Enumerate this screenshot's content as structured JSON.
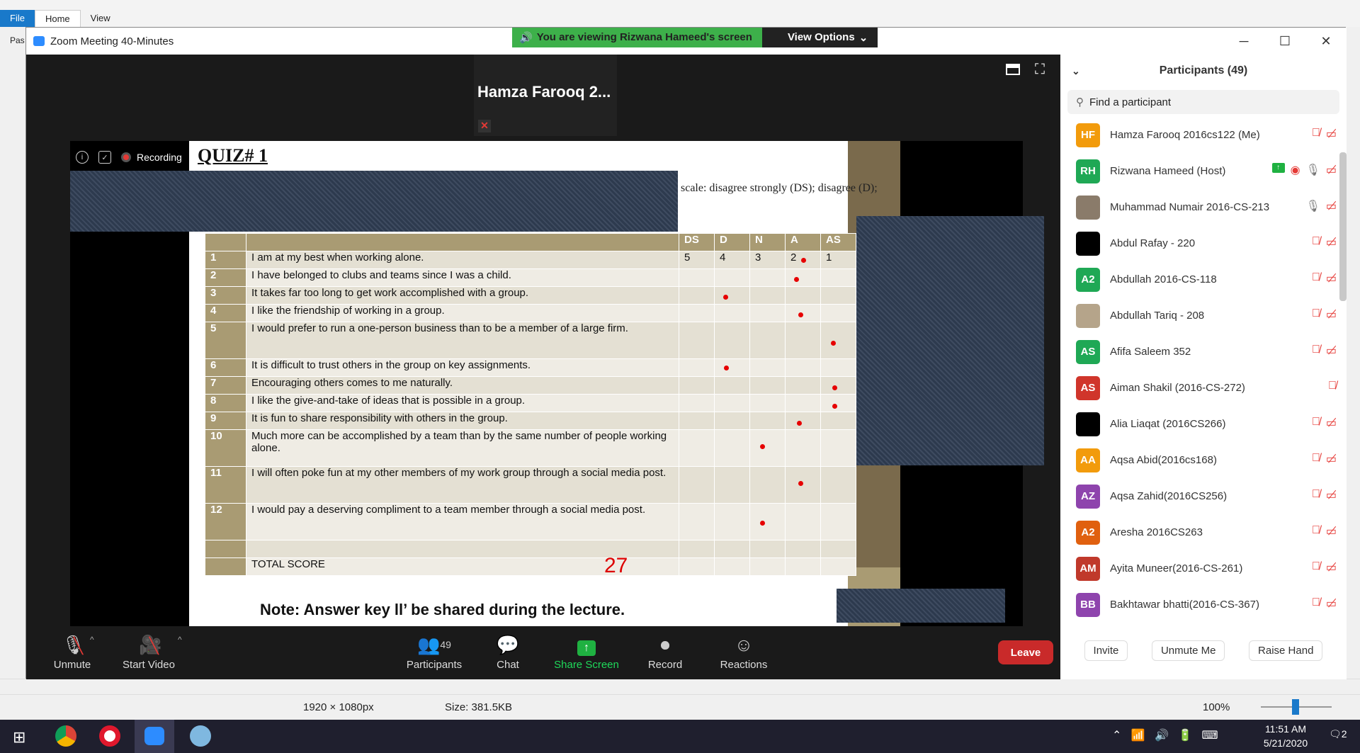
{
  "paint": {
    "tabs": [
      "File",
      "Home",
      "View"
    ],
    "paste_label": "Pas",
    "status": {
      "dimensions": "1920 × 1080px",
      "size": "Size: 381.5KB",
      "zoom": "100%"
    }
  },
  "zoom": {
    "window_title": "Zoom Meeting 40-Minutes",
    "viewing_banner": "You are viewing Rizwana Hameed's screen",
    "view_options": "View Options",
    "thumbnail_name": "Hamza Farooq 2...",
    "recording_label": "Recording"
  },
  "slide": {
    "title": "QUIZ# 1",
    "scale_text": "scale: disagree strongly (DS); disagree (D);",
    "columns": [
      "DS",
      "D",
      "N",
      "A",
      "AS"
    ],
    "scale_values": [
      "5",
      "4",
      "3",
      "2",
      "1"
    ],
    "questions": [
      {
        "num": "1",
        "text": "I am at my best when working alone."
      },
      {
        "num": "2",
        "text": "I have belonged to clubs and teams since I was a child."
      },
      {
        "num": "3",
        "text": "It takes far too long to get work accomplished with a group."
      },
      {
        "num": "4",
        "text": "I like the friendship of working in a group."
      },
      {
        "num": "5",
        "text": "I would prefer to run a one-person business than to be a member of a large firm."
      },
      {
        "num": "6",
        "text": "It is difficult to trust others in the group on key assignments."
      },
      {
        "num": "7",
        "text": "Encouraging others comes to me naturally."
      },
      {
        "num": "8",
        "text": "I like the give-and-take of ideas that is possible in a group."
      },
      {
        "num": "9",
        "text": "It is fun to share responsibility with others in the group."
      },
      {
        "num": "10",
        "text": "Much more can be accomplished by a team than by the same number of people working alone."
      },
      {
        "num": "11",
        "text": "I will often poke fun at my other members of my work group through a social media post."
      },
      {
        "num": "12",
        "text": "I would pay a deserving compliment to a team member through a social media post."
      }
    ],
    "total_label": "TOTAL SCORE",
    "total_value": "27",
    "note": "Note: Answer key ll’ be shared during the lecture."
  },
  "toolbar": {
    "unmute": "Unmute",
    "start_video": "Start Video",
    "participants": "Participants",
    "participants_count": "49",
    "chat": "Chat",
    "share_screen": "Share Screen",
    "record": "Record",
    "reactions": "Reactions",
    "leave": "Leave"
  },
  "panel": {
    "title": "Participants (49)",
    "search_placeholder": "Find a participant",
    "participants": [
      {
        "initials": "HF",
        "color": "#f29b0c",
        "name": "Hamza Farooq 2016cs122 (Me)"
      },
      {
        "initials": "RH",
        "color": "#1fa855",
        "name": "Rizwana Hameed (Host)"
      },
      {
        "initials": "",
        "color": "#8a7b6a",
        "name": "Muhammad Numair 2016-CS-213"
      },
      {
        "initials": "",
        "color": "#000000",
        "name": "Abdul Rafay - 220"
      },
      {
        "initials": "A2",
        "color": "#1fa855",
        "name": "Abdullah 2016-CS-118"
      },
      {
        "initials": "",
        "color": "#b5a48a",
        "name": "Abdullah Tariq - 208"
      },
      {
        "initials": "AS",
        "color": "#1fa855",
        "name": "Afifa Saleem 352"
      },
      {
        "initials": "AS",
        "color": "#d0352b",
        "name": "Aiman Shakil (2016-CS-272)"
      },
      {
        "initials": "",
        "color": "#000000",
        "name": "Alia Liaqat (2016CS266)"
      },
      {
        "initials": "AA",
        "color": "#f29b0c",
        "name": "Aqsa Abid(2016cs168)"
      },
      {
        "initials": "AZ",
        "color": "#8e44ad",
        "name": "Aqsa Zahid(2016CS256)"
      },
      {
        "initials": "A2",
        "color": "#e0600f",
        "name": "Aresha 2016CS263"
      },
      {
        "initials": "AM",
        "color": "#c0392b",
        "name": "Ayita Muneer(2016-CS-261)"
      },
      {
        "initials": "BB",
        "color": "#8e44ad",
        "name": "Bakhtawar bhatti(2016-CS-367)"
      }
    ],
    "invite": "Invite",
    "unmute_me": "Unmute Me",
    "raise_hand": "Raise Hand"
  },
  "taskbar": {
    "time": "11:51 AM",
    "date": "5/21/2020",
    "notifications": "2"
  }
}
